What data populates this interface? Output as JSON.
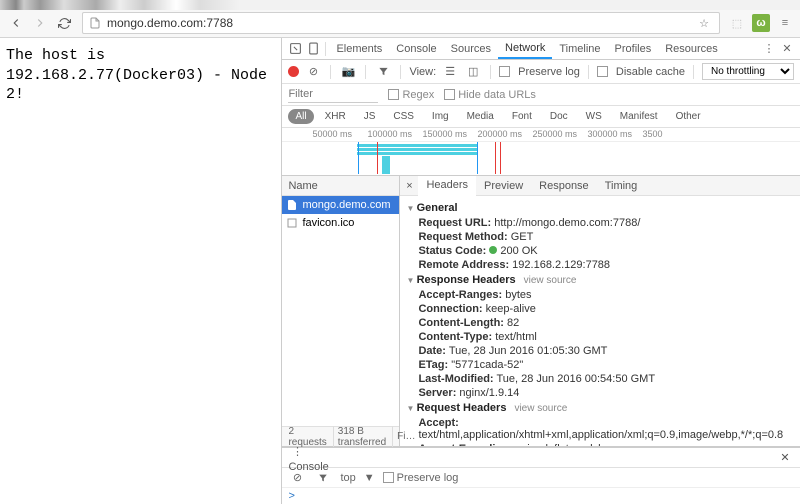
{
  "browser": {
    "url": "mongo.demo.com:7788"
  },
  "page": {
    "body_text": "The host is 192.168.2.77(Docker03) - Node 2!"
  },
  "devtools": {
    "tabs": [
      "Elements",
      "Console",
      "Sources",
      "Network",
      "Timeline",
      "Profiles",
      "Resources"
    ],
    "active_tab": "Network",
    "controls": {
      "view_label": "View:",
      "preserve_log": "Preserve log",
      "disable_cache": "Disable cache",
      "throttling": "No throttling"
    },
    "filter": {
      "placeholder": "Filter",
      "regex": "Regex",
      "hide_urls": "Hide data URLs"
    },
    "types": [
      "All",
      "XHR",
      "JS",
      "CSS",
      "Img",
      "Media",
      "Font",
      "Doc",
      "WS",
      "Manifest",
      "Other"
    ],
    "timeline_ticks": [
      "50000 ms",
      "100000 ms",
      "150000 ms",
      "200000 ms",
      "250000 ms",
      "300000 ms",
      "3500"
    ],
    "name_header": "Name",
    "requests": [
      {
        "name": "mongo.demo.com",
        "selected": true
      },
      {
        "name": "favicon.ico",
        "selected": false
      }
    ],
    "detail_tabs": [
      "Headers",
      "Preview",
      "Response",
      "Timing"
    ],
    "general_label": "General",
    "general": {
      "request_url_k": "Request URL:",
      "request_url_v": "http://mongo.demo.com:7788/",
      "request_method_k": "Request Method:",
      "request_method_v": "GET",
      "status_code_k": "Status Code:",
      "status_code_v": "200 OK",
      "remote_addr_k": "Remote Address:",
      "remote_addr_v": "192.168.2.129:7788"
    },
    "response_headers_label": "Response Headers",
    "view_source": "view source",
    "response_headers": {
      "accept_ranges_k": "Accept-Ranges:",
      "accept_ranges_v": "bytes",
      "connection_k": "Connection:",
      "connection_v": "keep-alive",
      "content_length_k": "Content-Length:",
      "content_length_v": "82",
      "content_type_k": "Content-Type:",
      "content_type_v": "text/html",
      "date_k": "Date:",
      "date_v": "Tue, 28 Jun 2016 01:05:30 GMT",
      "etag_k": "ETag:",
      "etag_v": "\"5771cada-52\"",
      "last_modified_k": "Last-Modified:",
      "last_modified_v": "Tue, 28 Jun 2016 00:54:50 GMT",
      "server_k": "Server:",
      "server_v": "nginx/1.9.14"
    },
    "request_headers_label": "Request Headers",
    "request_headers": {
      "accept_k": "Accept:",
      "accept_v": "text/html,application/xhtml+xml,application/xml;q=0.9,image/webp,*/*;q=0.8",
      "accept_encoding_k": "Accept-Encoding:",
      "accept_encoding_v": "gzip, deflate, sdch"
    },
    "status_bar": {
      "requests": "2 requests",
      "transferred": "318 B transferred",
      "finish": "Fi…"
    },
    "console": {
      "label": "Console",
      "scope": "top",
      "preserve": "Preserve log",
      "prompt": ">"
    }
  }
}
